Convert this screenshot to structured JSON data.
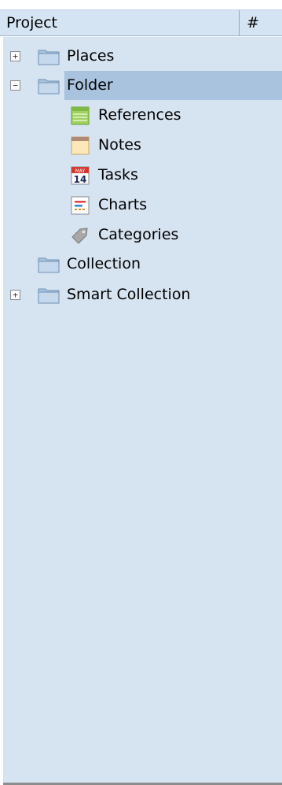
{
  "header": {
    "project_label": "Project",
    "count_label": "#"
  },
  "tree": {
    "items": [
      {
        "label": "Places",
        "icon": "folder-icon",
        "expander": "+"
      },
      {
        "label": "Folder",
        "icon": "folder-icon",
        "expander": "−",
        "selected": true
      },
      {
        "label": "References",
        "icon": "references-icon"
      },
      {
        "label": "Notes",
        "icon": "notes-icon"
      },
      {
        "label": "Tasks",
        "icon": "calendar-icon",
        "calendar_month": "MAY",
        "calendar_day": "14"
      },
      {
        "label": "Charts",
        "icon": "chart-icon"
      },
      {
        "label": "Categories",
        "icon": "tag-icon"
      },
      {
        "label": "Collection",
        "icon": "folder-icon"
      },
      {
        "label": "Smart Collection",
        "icon": "folder-icon",
        "expander": "+"
      }
    ]
  },
  "colors": {
    "header_bg": "#d5e4f3",
    "tree_bg": "#d6e3f1",
    "selection": "#a9c3de"
  }
}
